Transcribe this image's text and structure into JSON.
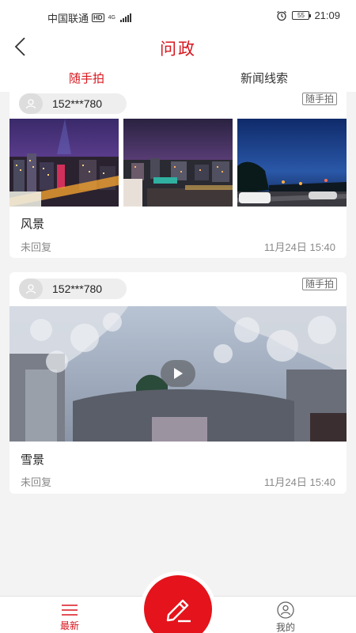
{
  "status_bar": {
    "carrier": "中国联通",
    "hd": "HD",
    "network": "4G",
    "battery": "55",
    "time": "21:09"
  },
  "header": {
    "title": "问政",
    "back_icon": "chevron-left-icon"
  },
  "tabs": [
    {
      "label": "随手拍",
      "active": true
    },
    {
      "label": "新闻线索",
      "active": false
    }
  ],
  "posts": [
    {
      "user": "152***780",
      "tag": "随手拍",
      "media": "photos",
      "title": "风景",
      "reply_status": "未回复",
      "time": "11月24日 15:40"
    },
    {
      "user": "152***780",
      "tag": "随手拍",
      "media": "video",
      "title": "雪景",
      "reply_status": "未回复",
      "time": "11月24日 15:40"
    }
  ],
  "bottom_nav": {
    "latest_label": "最新",
    "mine_label": "我的",
    "fab_icon": "pencil-icon"
  },
  "colors": {
    "accent": "#d8171f",
    "fab": "#e5131b",
    "background": "#f3f3f3"
  }
}
